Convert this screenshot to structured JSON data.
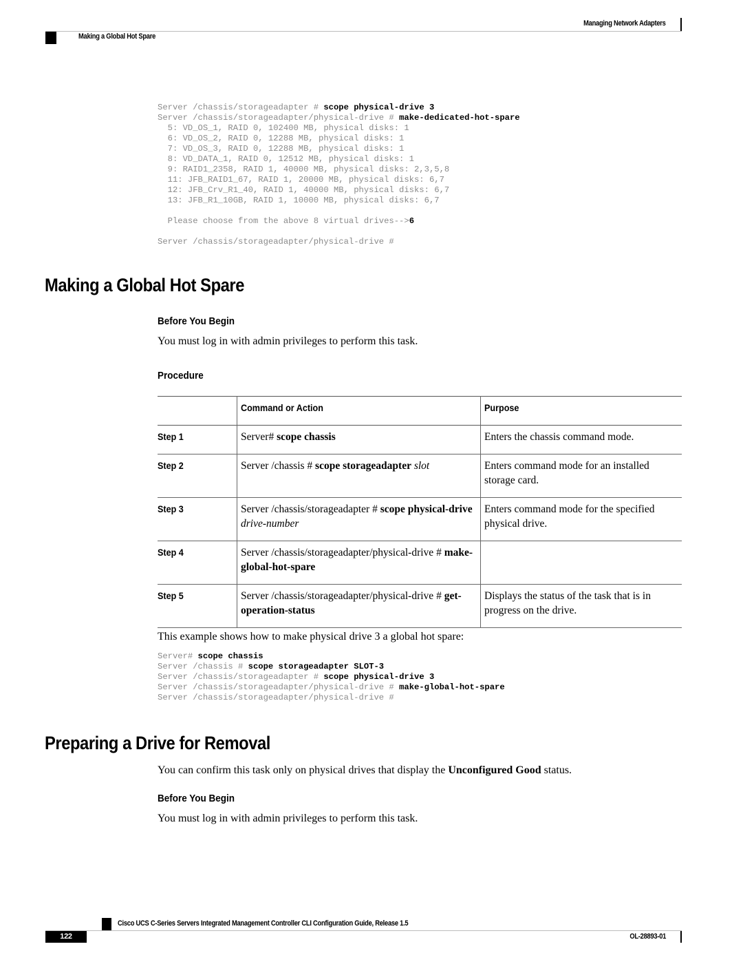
{
  "header": {
    "chapter": "Managing Network Adapters",
    "section": "Making a Global Hot Spare"
  },
  "code_block_1": [
    {
      "prompt": "Server /chassis/storageadapter # ",
      "cmd": "scope physical-drive 3"
    },
    {
      "prompt": "Server /chassis/storageadapter/physical-drive # ",
      "cmd": "make-dedicated-hot-spare"
    },
    {
      "prompt": "  5: VD_OS_1, RAID 0, 102400 MB, physical disks: 1",
      "cmd": ""
    },
    {
      "prompt": "  6: VD_OS_2, RAID 0, 12288 MB, physical disks: 1",
      "cmd": ""
    },
    {
      "prompt": "  7: VD_OS_3, RAID 0, 12288 MB, physical disks: 1",
      "cmd": ""
    },
    {
      "prompt": "  8: VD_DATA_1, RAID 0, 12512 MB, physical disks: 1",
      "cmd": ""
    },
    {
      "prompt": "  9: RAID1_2358, RAID 1, 40000 MB, physical disks: 2,3,5,8",
      "cmd": ""
    },
    {
      "prompt": "  11: JFB_RAID1_67, RAID 1, 20000 MB, physical disks: 6,7",
      "cmd": ""
    },
    {
      "prompt": "  12: JFB_Crv_R1_40, RAID 1, 40000 MB, physical disks: 6,7",
      "cmd": ""
    },
    {
      "prompt": "  13: JFB_R1_10GB, RAID 1, 10000 MB, physical disks: 6,7",
      "cmd": ""
    },
    {
      "prompt": "",
      "cmd": ""
    },
    {
      "prompt": "  Please choose from the above 8 virtual drives-->",
      "cmd": "6"
    },
    {
      "prompt": "",
      "cmd": ""
    },
    {
      "prompt": "Server /chassis/storageadapter/physical-drive #",
      "cmd": ""
    }
  ],
  "section1": {
    "title": "Making a Global Hot Spare",
    "before_you_begin_heading": "Before You Begin",
    "before_you_begin_text": "You must log in with admin privileges to perform this task.",
    "procedure_heading": "Procedure",
    "table": {
      "headers": [
        "",
        "Command or Action",
        "Purpose"
      ],
      "rows": [
        {
          "step": "Step 1",
          "cmd_prefix": "Server# ",
          "cmd_bold": "scope chassis",
          "cmd_italic": "",
          "purpose": "Enters the chassis command mode."
        },
        {
          "step": "Step 2",
          "cmd_prefix": "Server /chassis # ",
          "cmd_bold": "scope storageadapter",
          "cmd_italic": " slot",
          "purpose": "Enters command mode for an installed storage card."
        },
        {
          "step": "Step 3",
          "cmd_prefix": "Server /chassis/storageadapter # ",
          "cmd_bold": "scope physical-drive",
          "cmd_italic": " drive-number",
          "purpose": "Enters command mode for the specified physical drive."
        },
        {
          "step": "Step 4",
          "cmd_prefix": "Server /chassis/storageadapter/physical-drive # ",
          "cmd_bold": "make-global-hot-spare",
          "cmd_italic": "",
          "purpose": ""
        },
        {
          "step": "Step 5",
          "cmd_prefix": "Server /chassis/storageadapter/physical-drive # ",
          "cmd_bold": "get-operation-status",
          "cmd_italic": "",
          "purpose": "Displays the status of the task that is in progress on the drive."
        }
      ]
    },
    "example_text": "This example shows how to make physical drive 3 a global hot spare:",
    "example_code": [
      {
        "prompt": "Server# ",
        "cmd": "scope chassis"
      },
      {
        "prompt": "Server /chassis # ",
        "cmd": "scope storageadapter SLOT-3"
      },
      {
        "prompt": "Server /chassis/storageadapter # ",
        "cmd": "scope physical-drive 3"
      },
      {
        "prompt": "Server /chassis/storageadapter/physical-drive # ",
        "cmd": "make-global-hot-spare"
      },
      {
        "prompt": "Server /chassis/storageadapter/physical-drive #",
        "cmd": ""
      }
    ]
  },
  "section2": {
    "title": "Preparing a Drive for Removal",
    "intro_before": "You can confirm this task only on physical drives that display the ",
    "intro_bold": "Unconfigured Good",
    "intro_after": " status.",
    "before_you_begin_heading": "Before You Begin",
    "before_you_begin_text": "You must log in with admin privileges to perform this task."
  },
  "footer": {
    "guide_title": "Cisco UCS C-Series Servers Integrated Management Controller CLI Configuration Guide, Release 1.5",
    "page_number": "122",
    "doc_number": "OL-28893-01"
  }
}
